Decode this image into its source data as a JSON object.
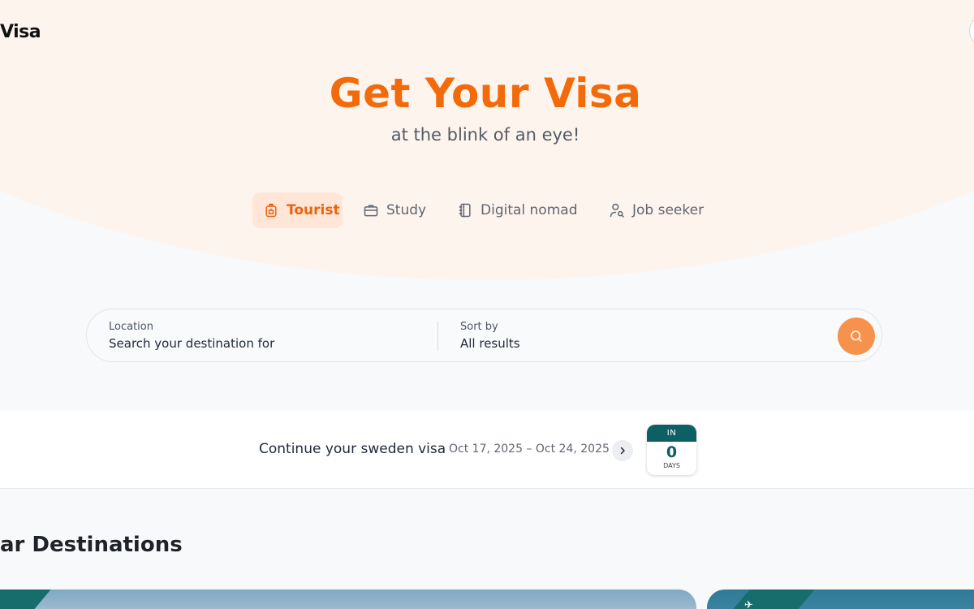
{
  "header": {
    "logo_text": "Visa"
  },
  "hero": {
    "title": "Get Your Visa",
    "subtitle": "at the blink of an eye!"
  },
  "tabs": [
    {
      "label": "Tourist",
      "icon": "backpack-icon",
      "active": true
    },
    {
      "label": "Study",
      "icon": "briefcase-icon",
      "active": false
    },
    {
      "label": "Digital nomad",
      "icon": "notebook-icon",
      "active": false
    },
    {
      "label": "Job seeker",
      "icon": "user-search-icon",
      "active": false
    }
  ],
  "search": {
    "location_label": "Location",
    "location_value": "Search your destination for",
    "sort_label": "Sort by",
    "sort_value": "All results",
    "button_icon": "search-icon"
  },
  "continue": {
    "text": "Continue your sweden visa",
    "dates": "Oct 17, 2025 – Oct 24, 2025",
    "arrow_icon": "chevron-right-icon",
    "countdown_label": "IN",
    "countdown_value": "0",
    "countdown_unit": "DAYS"
  },
  "destinations": {
    "title": "ar Destinations"
  },
  "colors": {
    "accent": "#f26a0a",
    "accent_soft": "#ffe6d6",
    "search_button": "#f7924d",
    "teal": "#0e5f63",
    "hero_background": "#fef4ee"
  }
}
